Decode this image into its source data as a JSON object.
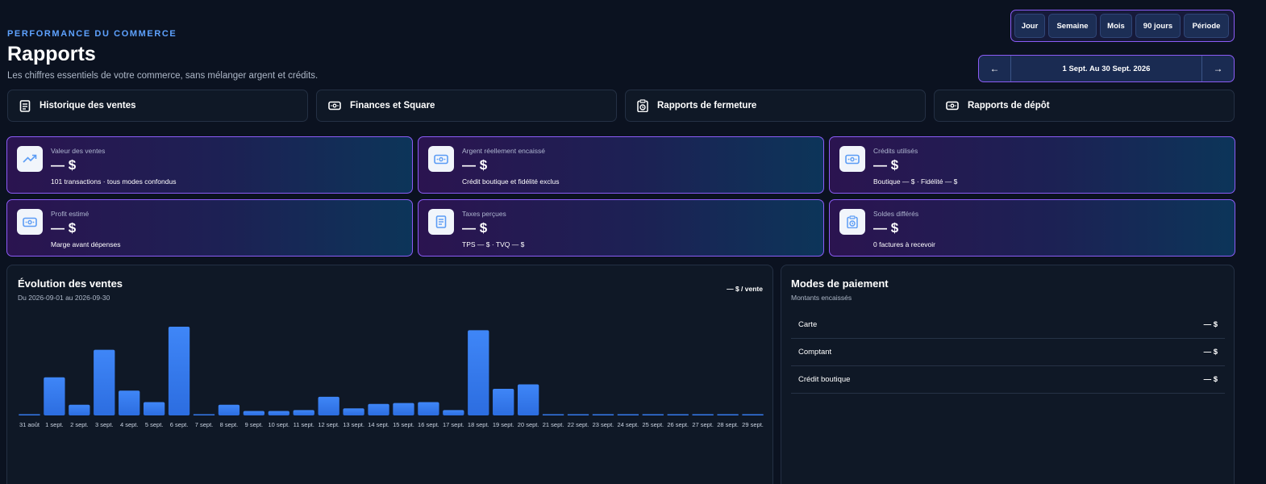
{
  "header": {
    "eyebrow": "PERFORMANCE DU COMMERCE",
    "title": "Rapports",
    "subtitle": "Les chiffres essentiels de votre commerce, sans mélanger argent et crédits."
  },
  "period_options": [
    "Jour",
    "Semaine",
    "Mois",
    "90 jours",
    "Période"
  ],
  "date_nav": {
    "prev_label": "←",
    "range_label": "1 Sept. Au 30 Sept. 2026",
    "next_label": "→"
  },
  "tabs": [
    {
      "label": "Historique des ventes",
      "icon": "receipt-icon"
    },
    {
      "label": "Finances et Square",
      "icon": "cash-icon"
    },
    {
      "label": "Rapports de fermeture",
      "icon": "clipboard-clock-icon"
    },
    {
      "label": "Rapports de dépôt",
      "icon": "cash-icon"
    }
  ],
  "kpis": [
    {
      "label": "Valeur des ventes",
      "value": "— $",
      "sub": "101 transactions · tous modes confondus",
      "icon": "trending-up-icon"
    },
    {
      "label": "Argent réellement encaissé",
      "value": "— $",
      "sub": "Crédit boutique et fidélité exclus",
      "icon": "cash-icon"
    },
    {
      "label": "Crédits utilisés",
      "value": "— $",
      "sub": "Boutique — $ · Fidélité — $",
      "icon": "cash-icon"
    },
    {
      "label": "Profit estimé",
      "value": "— $",
      "sub": "Marge avant dépenses",
      "icon": "cash-icon"
    },
    {
      "label": "Taxes perçues",
      "value": "— $",
      "sub": "TPS — $ · TVQ — $",
      "icon": "document-icon"
    },
    {
      "label": "Soldes différés",
      "value": "— $",
      "sub": "0 factures à recevoir",
      "icon": "clipboard-clock-icon"
    }
  ],
  "sales_panel": {
    "title": "Évolution des ventes",
    "subtitle": "Du 2026-09-01 au 2026-09-30",
    "per_sale": "— $ / vente"
  },
  "payment_panel": {
    "title": "Modes de paiement",
    "subtitle": "Montants encaissés",
    "rows": [
      {
        "label": "Carte",
        "amount": "— $"
      },
      {
        "label": "Comptant",
        "amount": "— $"
      },
      {
        "label": "Crédit boutique",
        "amount": "— $"
      }
    ]
  },
  "colors": {
    "accent": "#8b5cf6",
    "bar": "#3b82f6",
    "brand_blue": "#5ea2ff"
  },
  "chart_data": {
    "type": "bar",
    "categories": [
      "31 août",
      "1 sept.",
      "2 sept.",
      "3 sept.",
      "4 sept.",
      "5 sept.",
      "6 sept.",
      "7 sept.",
      "8 sept.",
      "9 sept.",
      "10 sept.",
      "11 sept.",
      "12 sept.",
      "13 sept.",
      "14 sept.",
      "15 sept.",
      "16 sept.",
      "17 sept.",
      "18 sept.",
      "19 sept.",
      "20 sept.",
      "21 sept.",
      "22 sept.",
      "23 sept.",
      "24 sept.",
      "25 sept.",
      "26 sept.",
      "27 sept.",
      "28 sept.",
      "29 sept."
    ],
    "values": [
      1,
      43,
      12,
      74,
      28,
      15,
      100,
      1,
      12,
      5,
      5,
      6,
      21,
      8,
      13,
      14,
      15,
      6,
      96,
      30,
      35,
      1,
      1,
      1,
      1,
      1,
      1,
      1,
      1,
      1
    ],
    "ylim": [
      0,
      100
    ],
    "grid": false
  }
}
